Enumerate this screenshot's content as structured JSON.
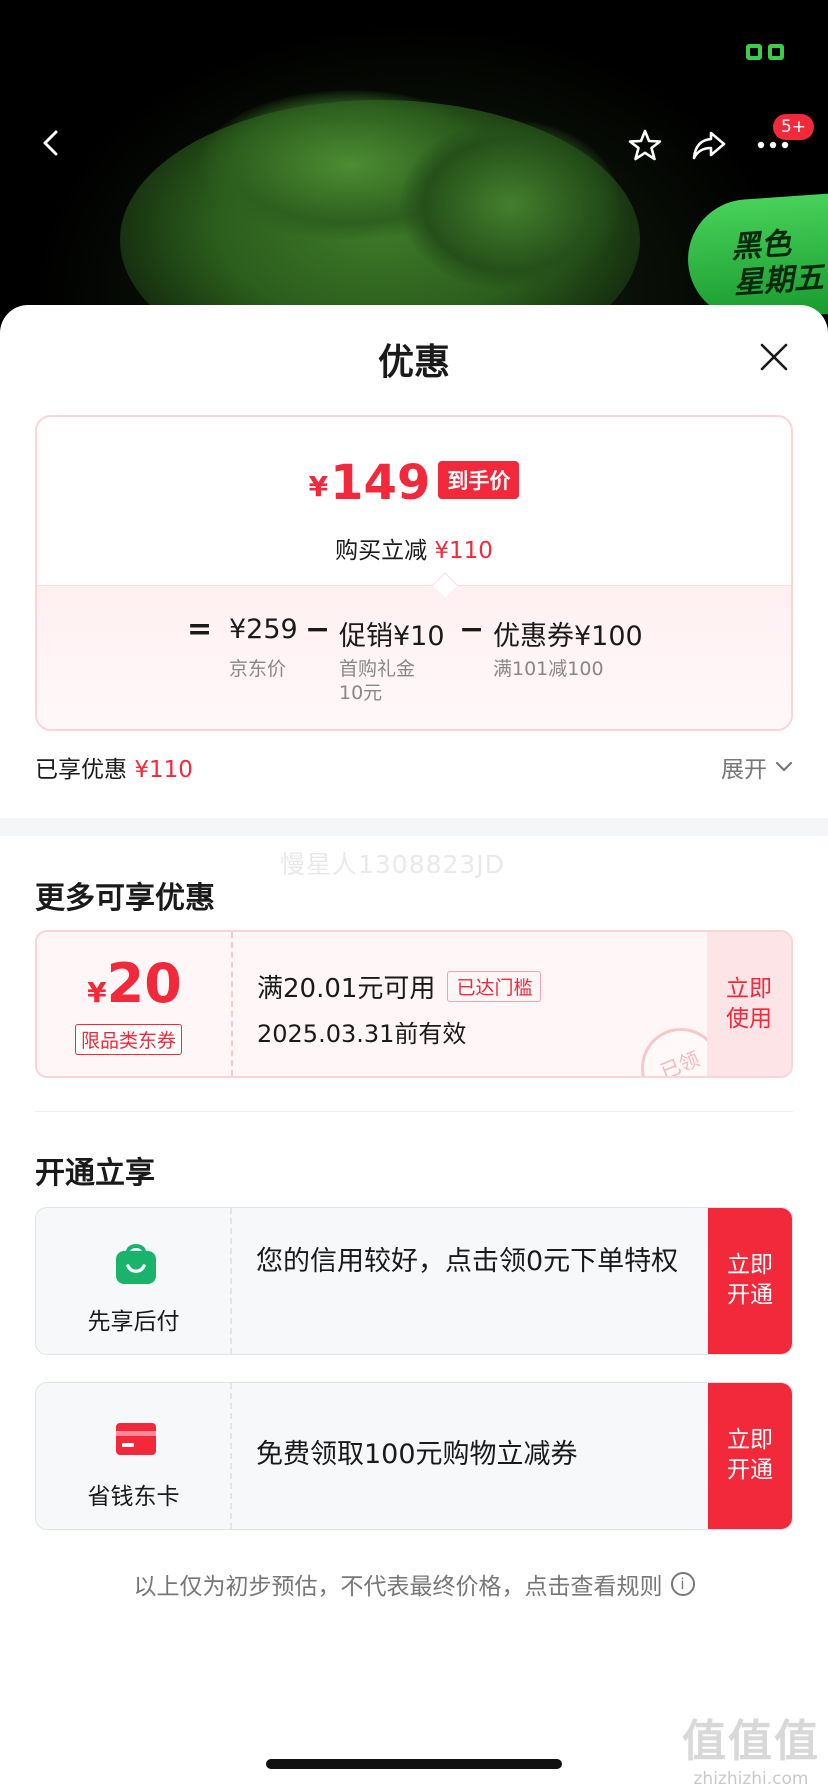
{
  "nav": {
    "badge": "5+",
    "promo_tag_line1": "黑色",
    "promo_tag_line2": "星期五"
  },
  "sheet": {
    "title": "优惠"
  },
  "price_summary": {
    "currency": "¥",
    "final_price": "149",
    "final_tag": "到手价",
    "reduce_label": "购买立减",
    "reduce_amount": "¥110",
    "equals": "=",
    "minus": "−",
    "jd_price": "¥259",
    "jd_price_label": "京东价",
    "promo_label": "促销¥10",
    "promo_sub_line1": "首购礼金",
    "promo_sub_line2": "10元",
    "coupon_label": "优惠券¥100",
    "coupon_sub": "满101减100"
  },
  "enjoyed": {
    "label": "已享优惠",
    "amount": "¥110",
    "expand_label": "展开"
  },
  "watermark": "慢星人1308823JD",
  "more_offers": {
    "title": "更多可享优惠",
    "coupon": {
      "currency": "¥",
      "amount": "20",
      "category": "限品类东券",
      "condition": "满20.01元可用",
      "status_tag": "已达门槛",
      "valid_until": "2025.03.31前有效",
      "button_line1": "立即",
      "button_line2": "使用",
      "stamp": "已领"
    }
  },
  "open_section": {
    "title": "开通立享",
    "cards": [
      {
        "label": "先享后付",
        "text": "您的信用较好，点击领0元下单特权",
        "button_line1": "立即",
        "button_line2": "开通"
      },
      {
        "label": "省钱东卡",
        "text": "免费领取100元购物立减券",
        "button_line1": "立即",
        "button_line2": "开通"
      }
    ]
  },
  "footer": {
    "note": "以上仅为初步预估，不代表最终价格，点击查看规则",
    "info_glyph": "i"
  },
  "site_mark": {
    "logo": "值值值",
    "url": "zhizhizhi.com"
  },
  "colors": {
    "accent_red": "#f2283b",
    "status_green": "#3ccd4a"
  }
}
